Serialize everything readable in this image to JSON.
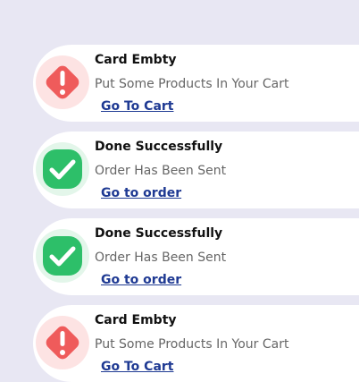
{
  "colors": {
    "background": "#e8e7f3",
    "card": "#ffffff",
    "error_halo": "#fde3e3",
    "error_icon": "#ef5b5b",
    "success_halo": "#e3f6ea",
    "success_icon": "#2dbf69",
    "link": "#1f3a93"
  },
  "notifications": [
    {
      "type": "error",
      "icon": "exclamation-diamond-icon",
      "title": "Card Embty",
      "message": "Put Some Products In Your Cart",
      "link": "Go To Cart"
    },
    {
      "type": "success",
      "icon": "check-square-icon",
      "title": "Done Successfully",
      "message": "Order Has Been Sent",
      "link": "Go to order"
    },
    {
      "type": "success",
      "icon": "check-square-icon",
      "title": "Done Successfully",
      "message": "Order Has Been Sent",
      "link": "Go to order"
    },
    {
      "type": "error",
      "icon": "exclamation-diamond-icon",
      "title": "Card Embty",
      "message": "Put Some Products In Your Cart",
      "link": "Go To Cart"
    }
  ]
}
